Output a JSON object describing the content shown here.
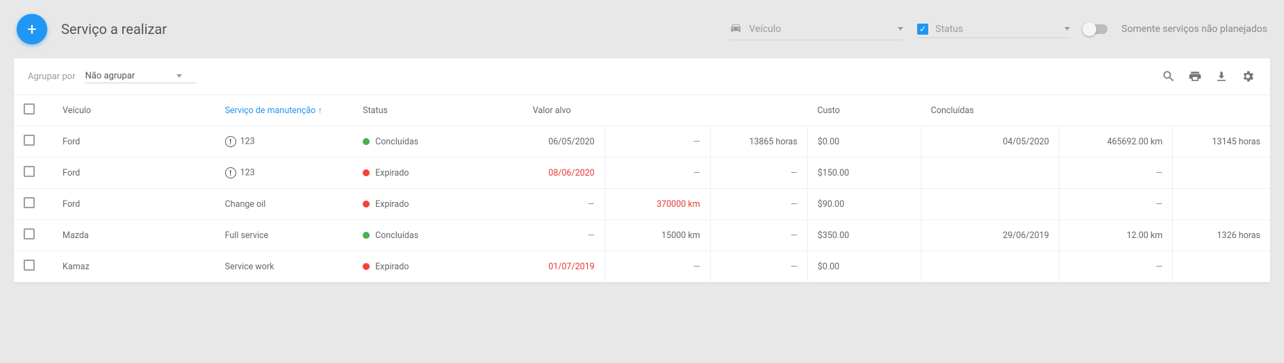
{
  "toolbar": {
    "title": "Serviço a realizar",
    "vehicle_filter_label": "Veículo",
    "status_filter_label": "Status",
    "status_filter_checked": true,
    "switch_label": "Somente serviços não planejados"
  },
  "card": {
    "group_by_label": "Agrupar por",
    "group_by_value": "Não agrupar"
  },
  "table": {
    "headers": {
      "vehicle": "Veículo",
      "service": "Serviço de manutenção",
      "status": "Status",
      "target": "Valor alvo",
      "cost": "Custo",
      "completed": "Concluídas"
    },
    "rows": [
      {
        "vehicle": "Ford",
        "service": "123",
        "warn": true,
        "status_label": "Concluídas",
        "status_color": "green",
        "target_date": "06/05/2020",
        "target_date_red": false,
        "target_km": "—",
        "target_km_red": false,
        "target_hrs": "13865 horas",
        "cost": "$0.00",
        "done_date": "04/05/2020",
        "done_km": "465692.00 km",
        "done_hrs": "13145 horas"
      },
      {
        "vehicle": "Ford",
        "service": "123",
        "warn": true,
        "status_label": "Expirado",
        "status_color": "red",
        "target_date": "08/06/2020",
        "target_date_red": true,
        "target_km": "—",
        "target_km_red": false,
        "target_hrs": "—",
        "cost": "$150.00",
        "done_date": "",
        "done_km": "—",
        "done_hrs": ""
      },
      {
        "vehicle": "Ford",
        "service": "Change oil",
        "warn": false,
        "status_label": "Expirado",
        "status_color": "red",
        "target_date": "—",
        "target_date_red": false,
        "target_km": "370000 km",
        "target_km_red": true,
        "target_hrs": "—",
        "cost": "$90.00",
        "done_date": "",
        "done_km": "—",
        "done_hrs": ""
      },
      {
        "vehicle": "Mazda",
        "service": "Full service",
        "warn": false,
        "status_label": "Concluídas",
        "status_color": "green",
        "target_date": "—",
        "target_date_red": false,
        "target_km": "15000 km",
        "target_km_red": false,
        "target_hrs": "—",
        "cost": "$350.00",
        "done_date": "29/06/2019",
        "done_km": "12.00 km",
        "done_hrs": "1326 horas"
      },
      {
        "vehicle": "Kamaz",
        "service": "Service work",
        "warn": false,
        "status_label": "Expirado",
        "status_color": "red",
        "target_date": "01/07/2019",
        "target_date_red": true,
        "target_km": "—",
        "target_km_red": false,
        "target_hrs": "—",
        "cost": "$0.00",
        "done_date": "",
        "done_km": "—",
        "done_hrs": ""
      }
    ]
  }
}
